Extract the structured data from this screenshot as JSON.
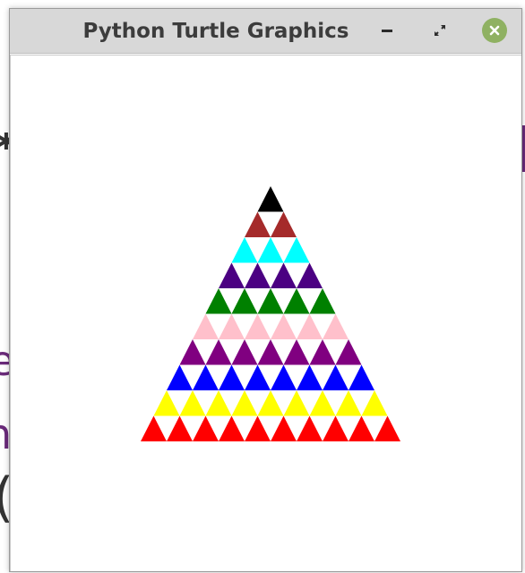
{
  "window": {
    "title": "Python Turtle Graphics"
  },
  "icons": {
    "minimize": "minimize-icon",
    "maximize": "maximize-icon",
    "close": "close-icon"
  },
  "colors": {
    "titlebar": "#d8d8d8",
    "close_button": "#8fb162",
    "canvas": "#ffffff"
  },
  "drawing": {
    "shape": "triangle",
    "rows": [
      {
        "count": 1,
        "color": "#000000"
      },
      {
        "count": 2,
        "color": "#a52a2a"
      },
      {
        "count": 3,
        "color": "#00ffff"
      },
      {
        "count": 4,
        "color": "#4b0082"
      },
      {
        "count": 5,
        "color": "#008000"
      },
      {
        "count": 6,
        "color": "#ffc0cb"
      },
      {
        "count": 7,
        "color": "#800080"
      },
      {
        "count": 8,
        "color": "#0000ff"
      },
      {
        "count": 9,
        "color": "#ffff00"
      },
      {
        "count": 10,
        "color": "#ff0000"
      }
    ]
  }
}
